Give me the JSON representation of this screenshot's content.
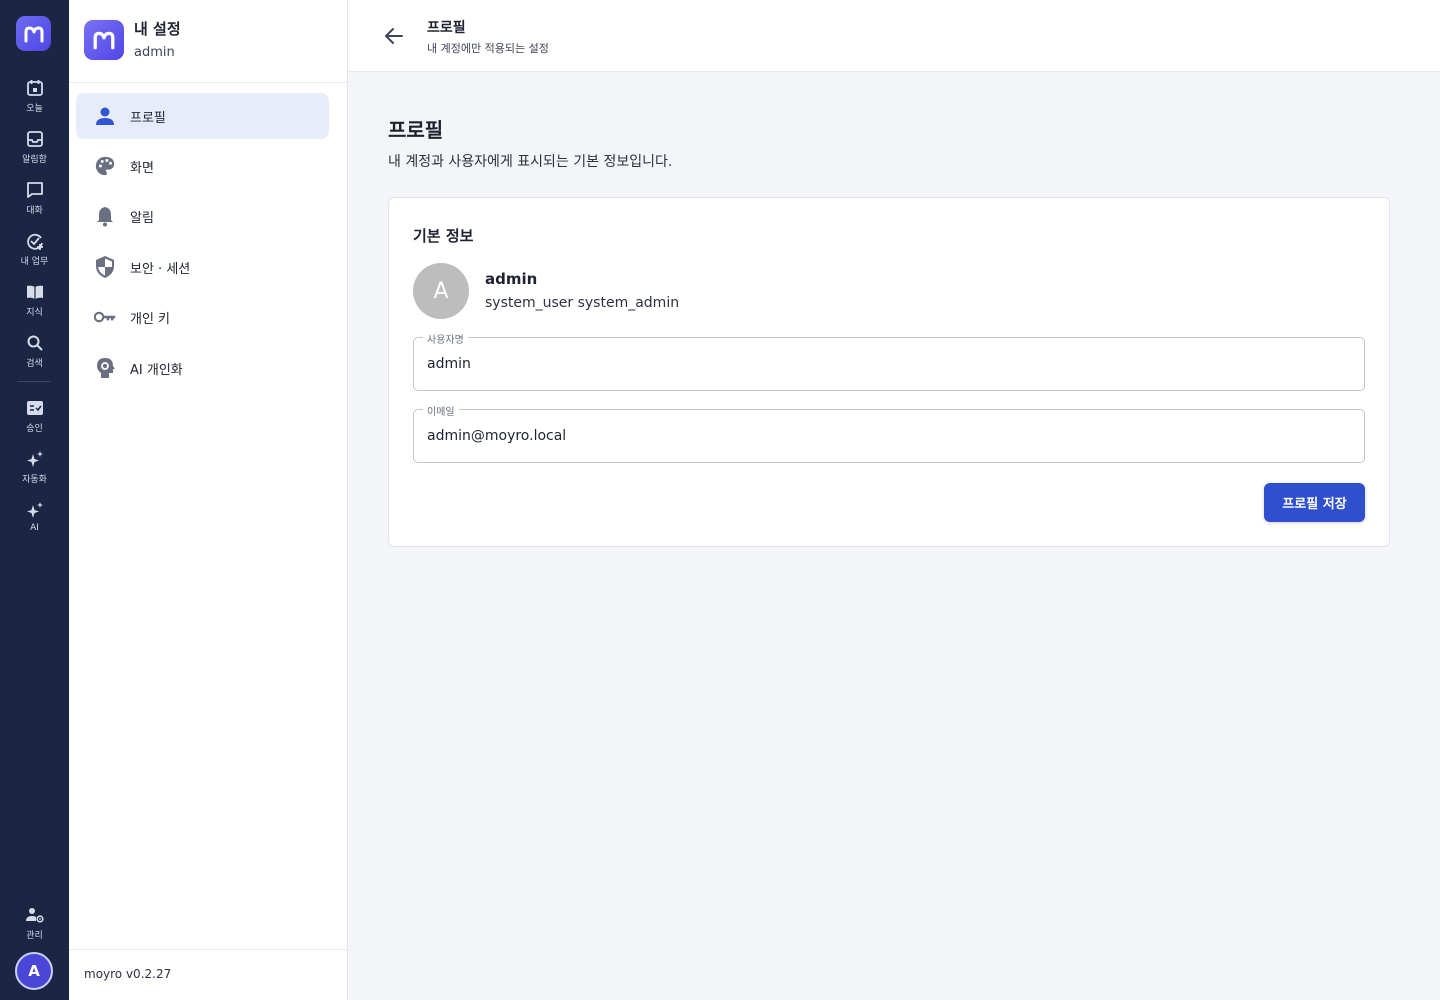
{
  "rail": {
    "items": [
      {
        "label": "오늘",
        "icon": "calendar-icon"
      },
      {
        "label": "알림함",
        "icon": "inbox-icon"
      },
      {
        "label": "대화",
        "icon": "chat-icon"
      },
      {
        "label": "내 업무",
        "icon": "task-check-icon"
      },
      {
        "label": "지식",
        "icon": "book-icon"
      },
      {
        "label": "검색",
        "icon": "search-icon"
      },
      {
        "label": "승인",
        "icon": "approval-icon"
      },
      {
        "label": "자동화",
        "icon": "sparkle-icon"
      },
      {
        "label": "AI",
        "icon": "sparkle-icon"
      },
      {
        "label": "관리",
        "icon": "admin-gear-icon"
      }
    ],
    "avatar_initial": "A"
  },
  "sidebar": {
    "title": "내 설정",
    "subtitle": "admin",
    "items": [
      {
        "label": "프로필",
        "icon": "person-icon",
        "active": true
      },
      {
        "label": "화면",
        "icon": "palette-icon"
      },
      {
        "label": "알림",
        "icon": "bell-icon"
      },
      {
        "label": "보안 · 세션",
        "icon": "shield-icon"
      },
      {
        "label": "개인 키",
        "icon": "key-icon"
      },
      {
        "label": "AI 개인화",
        "icon": "ai-head-icon"
      }
    ],
    "version": "moyro v0.2.27"
  },
  "header": {
    "title": "프로필",
    "subtitle": "내 계정에만 적용되는 설정"
  },
  "main": {
    "title": "프로필",
    "description": "내 계정과 사용자에게 표시되는 기본 정보입니다.",
    "card": {
      "title": "기본 정보",
      "avatar_initial": "A",
      "user_name": "admin",
      "user_roles": "system_user system_admin",
      "username_label": "사용자명",
      "username_value": "admin",
      "email_label": "이메일",
      "email_value": "admin@moyro.local",
      "save_label": "프로필 저장"
    }
  },
  "colors": {
    "rail_bg": "#1b2644",
    "accent": "#2f4fcf",
    "active_bg": "#e8ecf9",
    "avatar_gray": "#bdbdbd"
  }
}
